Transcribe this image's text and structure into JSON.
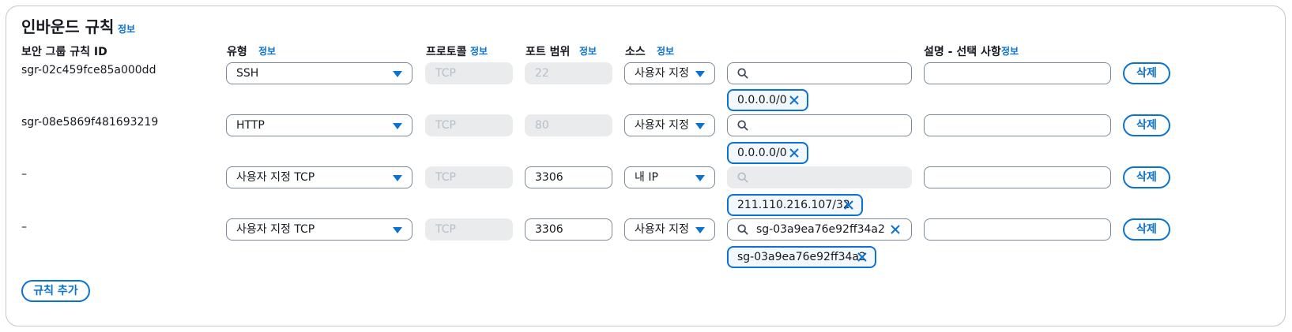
{
  "title": "인바운드 규칙",
  "info_label": "정보",
  "columns": {
    "rule_id": "보안 그룹 규칙 ID",
    "type": "유형",
    "protocol": "프로토콜",
    "port_range": "포트 범위",
    "source": "소스",
    "description": "설명 - 선택 사항"
  },
  "rows": [
    {
      "rule_id": "sgr-02c459fce85a000dd",
      "type": "SSH",
      "protocol": "TCP",
      "port": "22",
      "port_disabled": true,
      "source": "사용자 지정",
      "search_value": "",
      "search_disabled": false,
      "token": "0.0.0.0/0",
      "description": "",
      "delete_label": "삭제"
    },
    {
      "rule_id": "sgr-08e5869f481693219",
      "type": "HTTP",
      "protocol": "TCP",
      "port": "80",
      "port_disabled": true,
      "source": "사용자 지정",
      "search_value": "",
      "search_disabled": false,
      "token": "0.0.0.0/0",
      "description": "",
      "delete_label": "삭제"
    },
    {
      "rule_id": "–",
      "type": "사용자 지정 TCP",
      "protocol": "TCP",
      "port": "3306",
      "port_disabled": false,
      "source": "내 IP",
      "search_value": "",
      "search_disabled": true,
      "token": "211.110.216.107/32",
      "description": "",
      "delete_label": "삭제"
    },
    {
      "rule_id": "–",
      "type": "사용자 지정 TCP",
      "protocol": "TCP",
      "port": "3306",
      "port_disabled": false,
      "source": "사용자 지정",
      "search_value": "sg-03a9ea76e92ff34a2",
      "search_disabled": false,
      "token": "sg-03a9ea76e92ff34a2",
      "description": "",
      "delete_label": "삭제"
    }
  ],
  "add_rule_label": "규칙 추가",
  "colors": {
    "accent": "#0972d3",
    "border": "#7d8998",
    "disabled_bg": "#e9ebed",
    "disabled_text": "#b6bec9"
  }
}
